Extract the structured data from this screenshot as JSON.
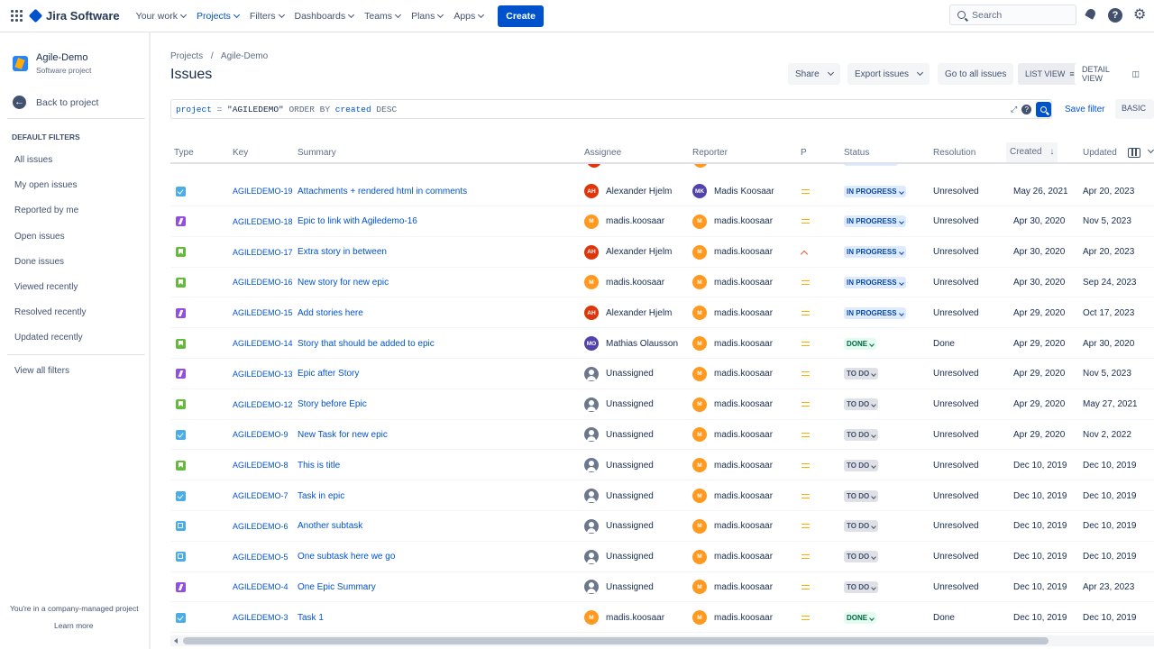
{
  "topnav": {
    "product": "Jira Software",
    "items": [
      {
        "label": "Your work",
        "active": false
      },
      {
        "label": "Projects",
        "active": true
      },
      {
        "label": "Filters",
        "active": false
      },
      {
        "label": "Dashboards",
        "active": false
      },
      {
        "label": "Teams",
        "active": false
      },
      {
        "label": "Plans",
        "active": false
      },
      {
        "label": "Apps",
        "active": false
      }
    ],
    "create_label": "Create",
    "search_placeholder": "Search"
  },
  "sidebar": {
    "project_name": "Agile-Demo",
    "project_type": "Software project",
    "back_label": "Back to project",
    "section_title": "DEFAULT FILTERS",
    "filters": [
      "All issues",
      "My open issues",
      "Reported by me",
      "Open issues",
      "Done issues",
      "Viewed recently",
      "Resolved recently",
      "Updated recently"
    ],
    "view_all": "View all filters",
    "footer_text": "You're in a company-managed project",
    "learn_more": "Learn more"
  },
  "header": {
    "breadcrumb_root": "Projects",
    "breadcrumb_sep": "/",
    "breadcrumb_project": "Agile-Demo",
    "title": "Issues",
    "share_label": "Share",
    "export_label": "Export issues",
    "go_all_label": "Go to all issues",
    "list_view_label": "LIST VIEW",
    "detail_view_label": "DETAIL VIEW"
  },
  "query": {
    "tokens": [
      "project",
      "=",
      "\"AGILEDEMO\"",
      "ORDER BY",
      "created",
      "DESC"
    ],
    "save_filter": "Save filter",
    "mode": "BASIC"
  },
  "table": {
    "columns": [
      "Type",
      "Key",
      "Summary",
      "Assignee",
      "Reporter",
      "P",
      "Status",
      "Resolution",
      "Created",
      "Updated"
    ],
    "sorted_column": "Created",
    "rows": [
      {
        "type": "task",
        "key": "AGILEDEMO-19",
        "summary": "Attachments + rendered html in comments",
        "assignee": "Alexander Hjelm",
        "assignee_initials": "AH",
        "assignee_color": "#de350b",
        "reporter": "Madis Koosaar",
        "reporter_initials": "MK",
        "reporter_color": "#5243aa",
        "priority": "medium",
        "status": "IN PROGRESS",
        "resolution": "Unresolved",
        "created": "May 26, 2021",
        "updated": "Apr 20, 2023"
      },
      {
        "type": "epic",
        "key": "AGILEDEMO-18",
        "summary": "Epic to link with Agiledemo-16",
        "assignee": "madis.koosaar",
        "assignee_initials": "M",
        "assignee_color": "#ff991f",
        "reporter": "madis.koosaar",
        "reporter_initials": "M",
        "reporter_color": "#ff991f",
        "priority": "medium",
        "status": "IN PROGRESS",
        "resolution": "Unresolved",
        "created": "Apr 30, 2020",
        "updated": "Nov 5, 2023"
      },
      {
        "type": "story",
        "key": "AGILEDEMO-17",
        "summary": "Extra story in between",
        "assignee": "Alexander Hjelm",
        "assignee_initials": "AH",
        "assignee_color": "#de350b",
        "reporter": "madis.koosaar",
        "reporter_initials": "M",
        "reporter_color": "#ff991f",
        "priority": "high",
        "status": "IN PROGRESS",
        "resolution": "Unresolved",
        "created": "Apr 30, 2020",
        "updated": "Apr 20, 2023"
      },
      {
        "type": "story",
        "key": "AGILEDEMO-16",
        "summary": "New story for new epic",
        "assignee": "madis.koosaar",
        "assignee_initials": "M",
        "assignee_color": "#ff991f",
        "reporter": "madis.koosaar",
        "reporter_initials": "M",
        "reporter_color": "#ff991f",
        "priority": "medium",
        "status": "IN PROGRESS",
        "resolution": "Unresolved",
        "created": "Apr 30, 2020",
        "updated": "Sep 24, 2023"
      },
      {
        "type": "epic",
        "key": "AGILEDEMO-15",
        "summary": "Add stories here",
        "assignee": "Alexander Hjelm",
        "assignee_initials": "AH",
        "assignee_color": "#de350b",
        "reporter": "madis.koosaar",
        "reporter_initials": "M",
        "reporter_color": "#ff991f",
        "priority": "medium",
        "status": "IN PROGRESS",
        "resolution": "Unresolved",
        "created": "Apr 29, 2020",
        "updated": "Oct 17, 2023"
      },
      {
        "type": "story",
        "key": "AGILEDEMO-14",
        "summary": "Story that should be added to epic",
        "assignee": "Mathias Olausson",
        "assignee_initials": "MO",
        "assignee_color": "#5243aa",
        "reporter": "madis.koosaar",
        "reporter_initials": "M",
        "reporter_color": "#ff991f",
        "priority": "medium",
        "status": "DONE",
        "resolution": "Done",
        "created": "Apr 29, 2020",
        "updated": "Apr 30, 2020"
      },
      {
        "type": "epic",
        "key": "AGILEDEMO-13",
        "summary": "Epic after Story",
        "assignee": "Unassigned",
        "assignee_initials": "",
        "assignee_color": "",
        "reporter": "madis.koosaar",
        "reporter_initials": "M",
        "reporter_color": "#ff991f",
        "priority": "medium",
        "status": "TO DO",
        "resolution": "Unresolved",
        "created": "Apr 29, 2020",
        "updated": "Nov 5, 2023"
      },
      {
        "type": "story",
        "key": "AGILEDEMO-12",
        "summary": "Story before Epic",
        "assignee": "Unassigned",
        "assignee_initials": "",
        "assignee_color": "",
        "reporter": "madis.koosaar",
        "reporter_initials": "M",
        "reporter_color": "#ff991f",
        "priority": "medium",
        "status": "TO DO",
        "resolution": "Unresolved",
        "created": "Apr 29, 2020",
        "updated": "May 27, 2021"
      },
      {
        "type": "task",
        "key": "AGILEDEMO-9",
        "summary": "New Task for new epic",
        "assignee": "Unassigned",
        "assignee_initials": "",
        "assignee_color": "",
        "reporter": "madis.koosaar",
        "reporter_initials": "M",
        "reporter_color": "#ff991f",
        "priority": "medium",
        "status": "TO DO",
        "resolution": "Unresolved",
        "created": "Apr 29, 2020",
        "updated": "Nov 2, 2022"
      },
      {
        "type": "story",
        "key": "AGILEDEMO-8",
        "summary": "This is title",
        "assignee": "Unassigned",
        "assignee_initials": "",
        "assignee_color": "",
        "reporter": "madis.koosaar",
        "reporter_initials": "M",
        "reporter_color": "#ff991f",
        "priority": "medium",
        "status": "TO DO",
        "resolution": "Unresolved",
        "created": "Dec 10, 2019",
        "updated": "Dec 10, 2019"
      },
      {
        "type": "task",
        "key": "AGILEDEMO-7",
        "summary": "Task in epic",
        "assignee": "Unassigned",
        "assignee_initials": "",
        "assignee_color": "",
        "reporter": "madis.koosaar",
        "reporter_initials": "M",
        "reporter_color": "#ff991f",
        "priority": "medium",
        "status": "TO DO",
        "resolution": "Unresolved",
        "created": "Dec 10, 2019",
        "updated": "Dec 10, 2019"
      },
      {
        "type": "subtask",
        "key": "AGILEDEMO-6",
        "summary": "Another subtask",
        "assignee": "Unassigned",
        "assignee_initials": "",
        "assignee_color": "",
        "reporter": "madis.koosaar",
        "reporter_initials": "M",
        "reporter_color": "#ff991f",
        "priority": "medium",
        "status": "TO DO",
        "resolution": "Unresolved",
        "created": "Dec 10, 2019",
        "updated": "Dec 10, 2019"
      },
      {
        "type": "subtask",
        "key": "AGILEDEMO-5",
        "summary": "One subtask here we go",
        "assignee": "Unassigned",
        "assignee_initials": "",
        "assignee_color": "",
        "reporter": "madis.koosaar",
        "reporter_initials": "M",
        "reporter_color": "#ff991f",
        "priority": "medium",
        "status": "TO DO",
        "resolution": "Unresolved",
        "created": "Dec 10, 2019",
        "updated": "Dec 10, 2019"
      },
      {
        "type": "epic",
        "key": "AGILEDEMO-4",
        "summary": "One Epic Summary",
        "assignee": "Unassigned",
        "assignee_initials": "",
        "assignee_color": "",
        "reporter": "madis.koosaar",
        "reporter_initials": "M",
        "reporter_color": "#ff991f",
        "priority": "medium",
        "status": "TO DO",
        "resolution": "Unresolved",
        "created": "Dec 10, 2019",
        "updated": "Apr 23, 2023"
      },
      {
        "type": "task",
        "key": "AGILEDEMO-3",
        "summary": "Task 1",
        "assignee": "madis.koosaar",
        "assignee_initials": "M",
        "assignee_color": "#ff991f",
        "reporter": "madis.koosaar",
        "reporter_initials": "M",
        "reporter_color": "#ff991f",
        "priority": "medium",
        "status": "DONE",
        "resolution": "Done",
        "created": "Dec 10, 2019",
        "updated": "Dec 10, 2019"
      }
    ]
  },
  "colors": {
    "brand": "#0052cc",
    "in_progress_bg": "#deebff",
    "todo_bg": "#dfe1e6",
    "done_bg": "#e3fcef"
  }
}
